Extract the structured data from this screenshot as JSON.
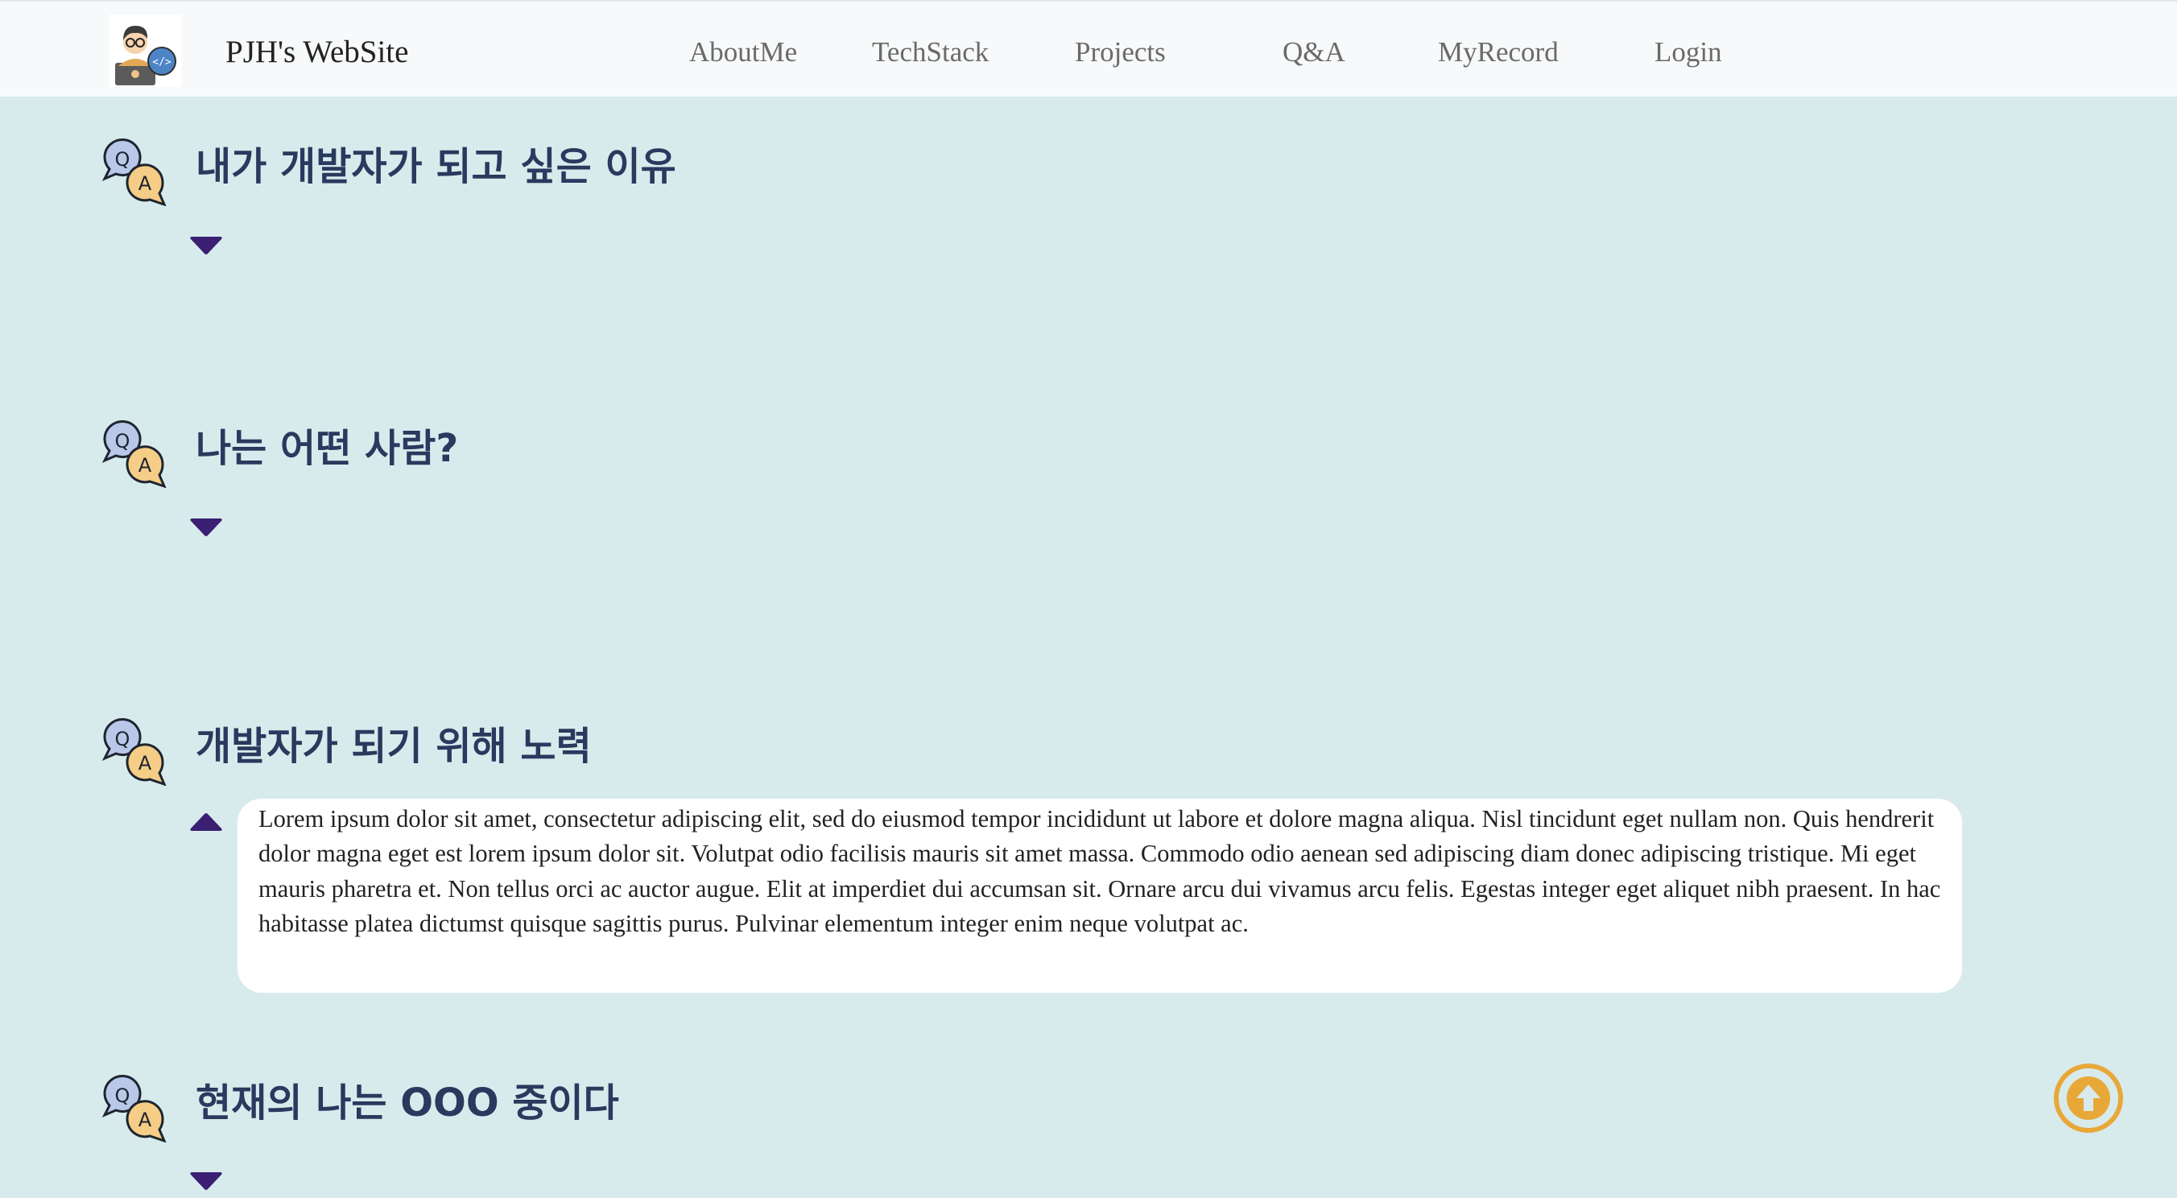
{
  "header": {
    "site_title": "PJH's WebSite",
    "logo_icon": "developer-avatar-icon",
    "nav": [
      "AboutMe",
      "TechStack",
      "Projects",
      "Q&A",
      "MyRecord",
      "Login"
    ]
  },
  "qa": [
    {
      "title": "내가 개발자가 되고 싶은 이유",
      "icon": "qa-bubbles-icon",
      "toggle": "chevron-down-icon",
      "expanded": false
    },
    {
      "title": "나는 어떤 사람?",
      "icon": "qa-bubbles-icon",
      "toggle": "chevron-down-icon",
      "expanded": false
    },
    {
      "title": "개발자가 되기 위해 노력",
      "icon": "qa-bubbles-icon",
      "toggle": "chevron-up-icon",
      "expanded": true,
      "answer": "Lorem ipsum dolor sit amet, consectetur adipiscing elit, sed do eiusmod tempor incididunt ut labore et dolore magna aliqua. Nisl tincidunt eget nullam non. Quis hendrerit dolor magna eget est lorem ipsum dolor sit. Volutpat odio facilisis mauris sit amet massa. Commodo odio aenean sed adipiscing diam donec adipiscing tristique. Mi eget mauris pharetra et. Non tellus orci ac auctor augue. Elit at imperdiet dui accumsan sit. Ornare arcu dui vivamus arcu felis. Egestas integer eget aliquet nibh praesent. In hac habitasse platea dictumst quisque sagittis purus. Pulvinar elementum integer enim neque volutpat ac."
    },
    {
      "title": "현재의 나는 OOO 중이다",
      "icon": "qa-bubbles-icon",
      "toggle": "chevron-down-icon",
      "expanded": false
    }
  ],
  "scroll_top_button": {
    "icon": "arrow-up-circle-icon"
  },
  "colors": {
    "background": "#d8ebec",
    "navbar": "#f7f9fa",
    "title": "#283a5e",
    "toggle": "#3a1f72",
    "scroll_top": "#e8a838"
  }
}
